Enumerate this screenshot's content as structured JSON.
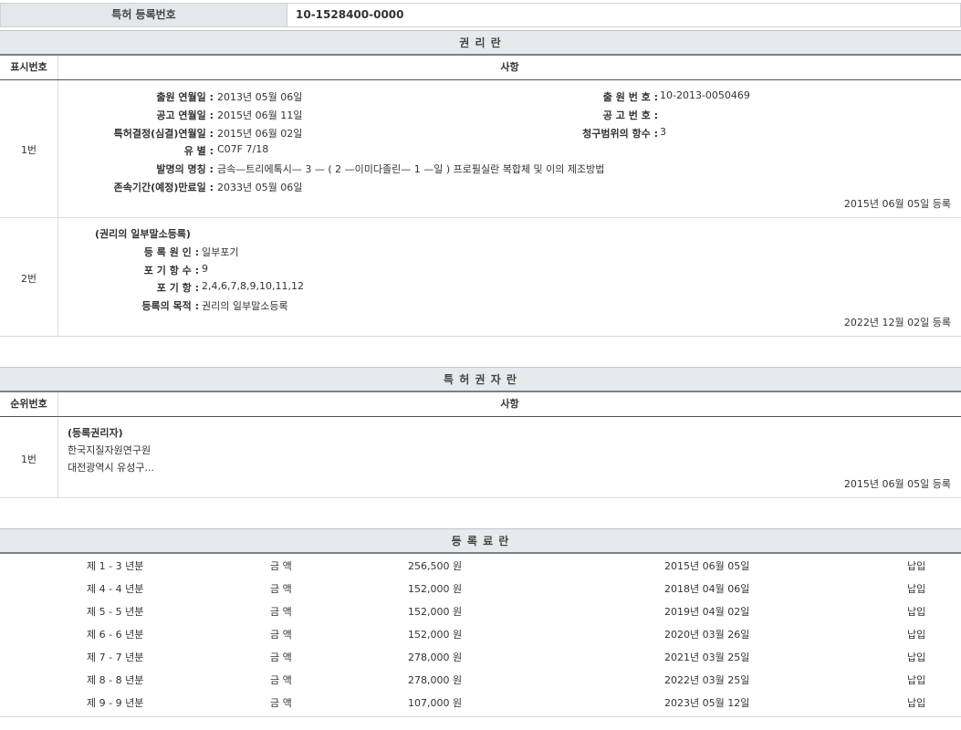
{
  "registration": {
    "label": "특허 등록번호",
    "number": "10-1528400-0000"
  },
  "rights_section": {
    "title": "권 리 란",
    "col_number": "표시번호",
    "col_content": "사항",
    "entry1": {
      "number": "1번",
      "filing_date_label": "출원 연월일 :",
      "filing_date": "2013년 05월 06일",
      "application_no_label": "출 원 번 호 :",
      "application_no": "10-2013-0050469",
      "publication_date_label": "공고 연월일 :",
      "publication_date": "2015년 06월 11일",
      "publication_no_label": "공 고 번 호 :",
      "publication_no": "",
      "decision_date_label": "특허결정(심결)연월일 :",
      "decision_date": "2015년 06월 02일",
      "claims_label": "청구범위의 항수 :",
      "claims": "3",
      "classification_label": "유 별 :",
      "classification": "C07F 7/18",
      "invention_title_label": "발명의 명칭 :",
      "invention_title": "금속—트리에톡시— 3 — ( 2 —이미다졸린— 1 —일 ) 프로필실란 복합체 및 이의 제조방법",
      "expiry_label": "존속기간(예정)만료일 :",
      "expiry": "2033년 05월 06일",
      "reg_date": "2015년 06월 05일 등록"
    },
    "entry2": {
      "number": "2번",
      "heading": "(권리의 일부말소등록)",
      "cause_label": "등 록 원 인 :",
      "cause": "일부포기",
      "waived_count_label": "포 기 항 수 :",
      "waived_count": "9",
      "waived_claims_label": "포 기 항 :",
      "waived_claims": "2,4,6,7,8,9,10,11,12",
      "purpose_label": "등록의 목적 :",
      "purpose": "권리의 일부말소등록",
      "reg_date": "2022년 12월 02일 등록"
    }
  },
  "holder_section": {
    "title": "특 허 권 자 란",
    "col_number": "순위번호",
    "col_content": "사항",
    "entry1": {
      "number": "1번",
      "heading": "(등록권리자)",
      "name": "한국지질자원연구원",
      "address": "대전광역시 유성구...",
      "reg_date": "2015년 06월 05일 등록"
    }
  },
  "fee_section": {
    "title": "등 록 료 란",
    "rows": [
      {
        "period": "제 1 - 3 년분",
        "label": "금 액",
        "amount": "256,500 원",
        "date": "2015년 06월 05일",
        "status": "납입"
      },
      {
        "period": "제 4 - 4 년분",
        "label": "금 액",
        "amount": "152,000 원",
        "date": "2018년 04월 06일",
        "status": "납입"
      },
      {
        "period": "제 5 - 5 년분",
        "label": "금 액",
        "amount": "152,000 원",
        "date": "2019년 04월 02일",
        "status": "납입"
      },
      {
        "period": "제 6 - 6 년분",
        "label": "금 액",
        "amount": "152,000 원",
        "date": "2020년 03월 26일",
        "status": "납입"
      },
      {
        "period": "제 7 - 7 년분",
        "label": "금 액",
        "amount": "278,000 원",
        "date": "2021년 03월 25일",
        "status": "납입"
      },
      {
        "period": "제 8 - 8 년분",
        "label": "금 액",
        "amount": "278,000 원",
        "date": "2022년 03월 25일",
        "status": "납입"
      },
      {
        "period": "제 9 - 9 년분",
        "label": "금 액",
        "amount": "107,000 원",
        "date": "2023년 05월 12일",
        "status": "납입"
      }
    ]
  }
}
